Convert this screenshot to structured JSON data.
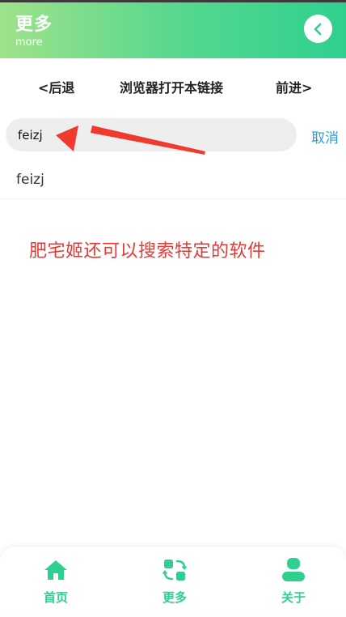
{
  "header": {
    "title": "更多",
    "subtitle": "more"
  },
  "navbar": {
    "back_label": "<后退",
    "open_in_browser_label": "浏览器打开本链接",
    "forward_label": "前进>"
  },
  "search": {
    "value": "feizj",
    "cancel_label": "取消"
  },
  "results": [
    {
      "label": "feizj"
    }
  ],
  "annotation": {
    "text": "肥宅姬还可以搜索特定的软件"
  },
  "tabbar": {
    "items": [
      {
        "label": "首页",
        "icon": "home-icon"
      },
      {
        "label": "更多",
        "icon": "switch-icon"
      },
      {
        "label": "关于",
        "icon": "user-icon"
      }
    ]
  },
  "colors": {
    "accent": "#2fcf8f",
    "link": "#2f9ed8",
    "annotation": "#e53935"
  }
}
